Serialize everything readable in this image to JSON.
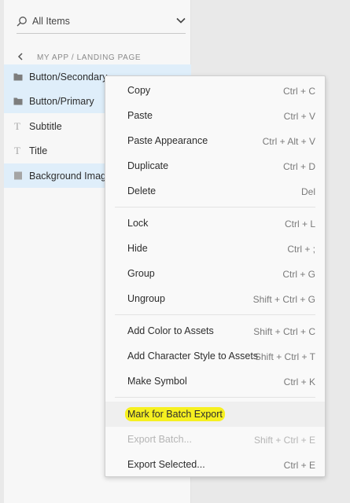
{
  "search": {
    "value": "All Items"
  },
  "breadcrumb": {
    "path": "MY APP / LANDING PAGE"
  },
  "layers": [
    {
      "label": "Button/Secondary",
      "icon": "folder-icon",
      "selected": true
    },
    {
      "label": "Button/Primary",
      "icon": "folder-icon",
      "selected": true
    },
    {
      "label": "Subtitle",
      "icon": "text-icon",
      "selected": false
    },
    {
      "label": "Title",
      "icon": "text-icon",
      "selected": false
    },
    {
      "label": "Background Image",
      "icon": "rectangle-icon",
      "selected": true
    }
  ],
  "menu": {
    "items": [
      {
        "label": "Copy",
        "shortcut": "Ctrl + C"
      },
      {
        "label": "Paste",
        "shortcut": "Ctrl + V"
      },
      {
        "label": "Paste Appearance",
        "shortcut": "Ctrl + Alt + V"
      },
      {
        "label": "Duplicate",
        "shortcut": "Ctrl + D"
      },
      {
        "label": "Delete",
        "shortcut": "Del"
      },
      {
        "label": "Lock",
        "shortcut": "Ctrl + L"
      },
      {
        "label": "Hide",
        "shortcut": "Ctrl + ;"
      },
      {
        "label": "Group",
        "shortcut": "Ctrl + G"
      },
      {
        "label": "Ungroup",
        "shortcut": "Shift + Ctrl + G"
      },
      {
        "label": "Add Color to Assets",
        "shortcut": "Shift + Ctrl + C"
      },
      {
        "label": "Add Character Style to Assets",
        "shortcut": "Shift + Ctrl + T"
      },
      {
        "label": "Make Symbol",
        "shortcut": "Ctrl + K"
      },
      {
        "label": "Mark for Batch Export",
        "shortcut": ""
      },
      {
        "label": "Export Batch...",
        "shortcut": "Shift + Ctrl + E",
        "disabled": true
      },
      {
        "label": "Export Selected...",
        "shortcut": "Ctrl + E"
      }
    ]
  },
  "colors": {
    "selection": "#dfeefa",
    "highlight": "#f6f020"
  }
}
